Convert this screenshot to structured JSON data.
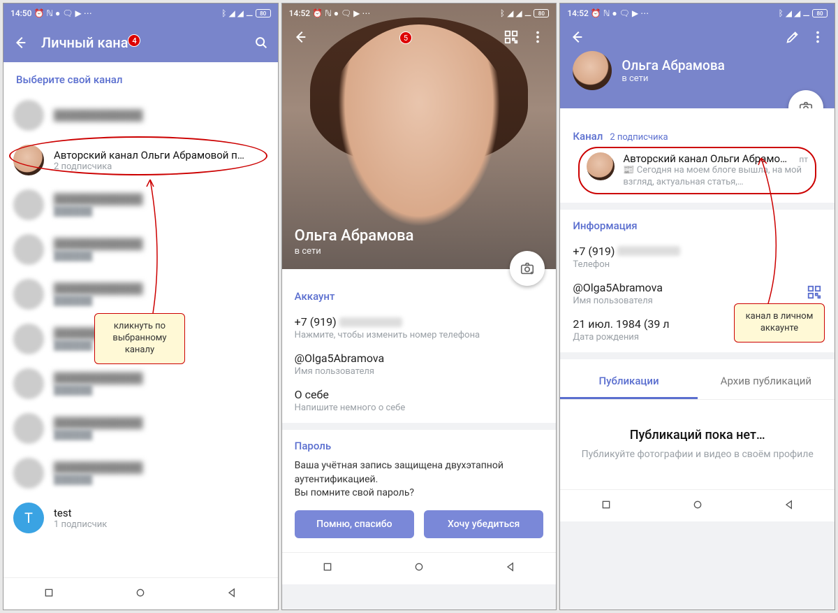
{
  "badges": {
    "s1": "4",
    "s2": "5"
  },
  "status": {
    "time1": "14:50",
    "time2": "14:52",
    "time3": "14:52",
    "battery": "80"
  },
  "s1": {
    "title": "Личный кана",
    "section": "Выберите свой канал",
    "channel_title": "Авторский канал Ольги Абрамовой п…",
    "channel_sub": "2 подписчика",
    "callout": "кликнуть по выбранному каналу",
    "test_title": "test",
    "test_sub": "1 подписчик"
  },
  "s2": {
    "name": "Ольга Абрамова",
    "status": "в сети",
    "account_label": "Аккаунт",
    "phone": "+7 (919)",
    "phone_hint": "Нажмите, чтобы изменить номер телефона",
    "username": "@Olga5Abramova",
    "username_label": "Имя пользователя",
    "about": "О себе",
    "about_hint": "Напишите немного о себе",
    "password_label": "Пароль",
    "password_text": "Ваша учётная запись защищена двухэтапной аутентификацией.\nВы помните свой пароль?",
    "btn_ok": "Помню, спасибо",
    "btn_check": "Хочу убедиться"
  },
  "s3": {
    "name": "Ольга Абрамова",
    "status": "в сети",
    "channel_label": "Канал",
    "channel_subs": "2 подписчика",
    "channel_title": "Авторский канал Ольги Абрамо…",
    "channel_day": "пт",
    "channel_preview": "📰 Сегодня на моем блоге вышла, на мой взгляд, актуальная статья,…",
    "info_label": "Информация",
    "phone": "+7 (919)",
    "phone_label": "Телефон",
    "username": "@Olga5Abramova",
    "username_label": "Имя пользователя",
    "birth": "21 июл. 1984 (39 л",
    "birth_label": "Дата рождения",
    "callout": "канал в личном аккаунте",
    "tab1": "Публикации",
    "tab2": "Архив публикаций",
    "empty_title": "Публикаций пока нет…",
    "empty_sub": "Публикуйте фотографии и видео в своём профиле"
  }
}
